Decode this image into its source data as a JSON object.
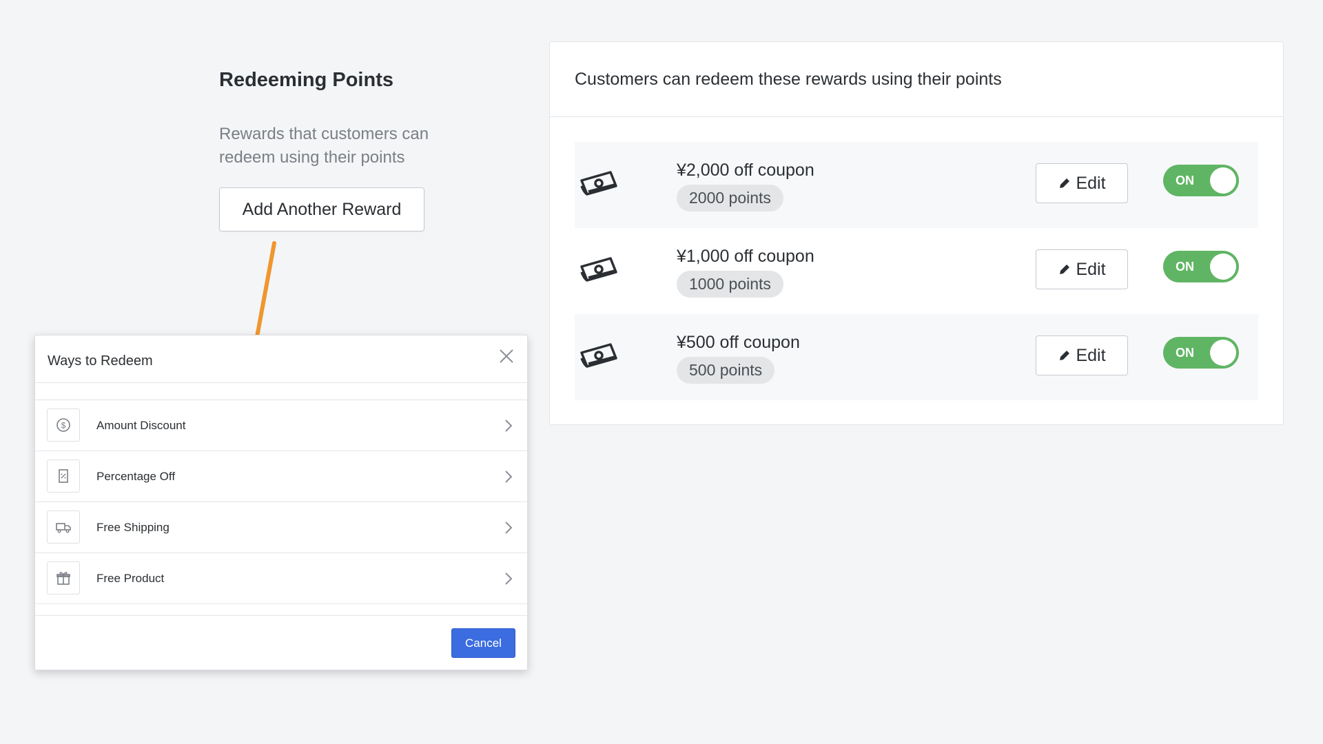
{
  "left_section": {
    "title": "Redeeming Points",
    "description": "Rewards that customers can redeem using their points",
    "add_button_label": "Add Another Reward"
  },
  "rewards_card": {
    "header": "Customers can redeem these rewards using their points",
    "rewards": [
      {
        "name": "¥2,000 off coupon",
        "points": "2000 points",
        "edit_label": "Edit",
        "toggle_label": "ON",
        "enabled": true,
        "icon": "money-icon"
      },
      {
        "name": "¥1,000 off coupon",
        "points": "1000 points",
        "edit_label": "Edit",
        "toggle_label": "ON",
        "enabled": true,
        "icon": "money-icon"
      },
      {
        "name": "¥500 off coupon",
        "points": "500 points",
        "edit_label": "Edit",
        "toggle_label": "ON",
        "enabled": true,
        "icon": "money-icon"
      }
    ]
  },
  "modal": {
    "title": "Ways to Redeem",
    "options": [
      {
        "label": "Amount Discount",
        "icon": "dollar-circle-icon"
      },
      {
        "label": "Percentage Off",
        "icon": "percent-receipt-icon"
      },
      {
        "label": "Free Shipping",
        "icon": "truck-icon"
      },
      {
        "label": "Free Product",
        "icon": "gift-icon"
      }
    ],
    "cancel_label": "Cancel"
  },
  "colors": {
    "toggle_on": "#5fb563",
    "primary_button": "#3b6ce0",
    "annotation_arrow": "#f0962e",
    "background": "#f4f5f7"
  }
}
